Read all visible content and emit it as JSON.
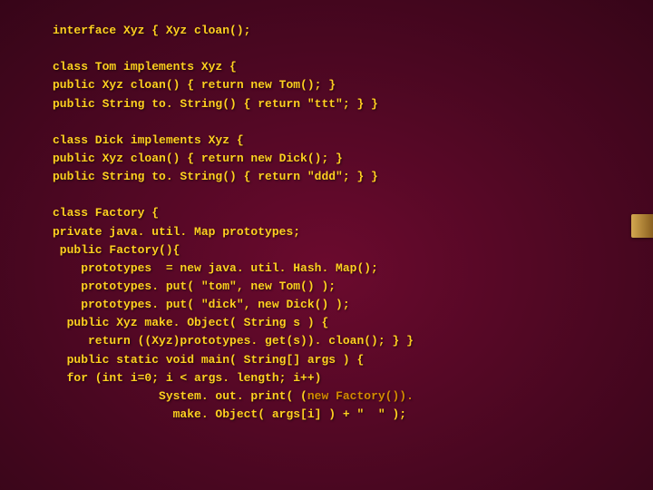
{
  "code_lines": [
    "interface Xyz { Xyz cloan();",
    "",
    "class Tom implements Xyz {",
    "public Xyz cloan() { return new Tom(); }",
    "public String to. String() { return \"ttt\"; } }",
    "",
    "class Dick implements Xyz {",
    "public Xyz cloan() { return new Dick(); }",
    "public String to. String() { return \"ddd\"; } }",
    "",
    "class Factory {",
    "private java. util. Map prototypes;",
    " public Factory(){",
    "    prototypes  = new java. util. Hash. Map();",
    "    prototypes. put( \"tom\", new Tom() );",
    "    prototypes. put( \"dick\", new Dick() );",
    "  public Xyz make. Object( String s ) {",
    "     return ((Xyz)prototypes. get(s)). cloan(); } }",
    "  public static void main( String[] args ) {",
    "  for (int i=0; i < args. length; i++)",
    "               System. out. print( (new Factory()).",
    "                 make. Object( args[i] ) + \"  \" );"
  ],
  "highlight_tokens": [
    "new Factory())."
  ]
}
